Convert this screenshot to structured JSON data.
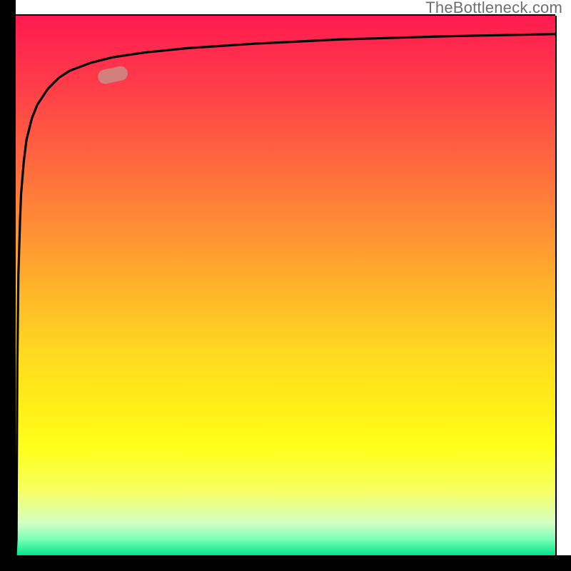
{
  "attribution": "TheBottleneck.com",
  "colors": {
    "axis": "#000000",
    "curve": "#000000",
    "marker_fill": "#ca8d87",
    "marker_opacity": 0.85,
    "gradient_stops": [
      {
        "offset": 0,
        "color": "#ff1a4f"
      },
      {
        "offset": 12,
        "color": "#ff3a4a"
      },
      {
        "offset": 25,
        "color": "#ff6140"
      },
      {
        "offset": 38,
        "color": "#ff8a36"
      },
      {
        "offset": 50,
        "color": "#ffb22a"
      },
      {
        "offset": 62,
        "color": "#ffd820"
      },
      {
        "offset": 72,
        "color": "#ffee18"
      },
      {
        "offset": 80,
        "color": "#ffff1a"
      },
      {
        "offset": 88,
        "color": "#f7ff60"
      },
      {
        "offset": 94,
        "color": "#d4ffc4"
      },
      {
        "offset": 97,
        "color": "#7bffb7"
      },
      {
        "offset": 100,
        "color": "#00e68a"
      }
    ]
  },
  "chart_data": {
    "type": "line",
    "title": "",
    "xlabel": "",
    "ylabel": "",
    "xlim": [
      0,
      100
    ],
    "ylim": [
      0,
      100
    ],
    "series": [
      {
        "name": "curve",
        "description": "Steep rise from origin approaching an upper asymptote near y≈97; visually a logarithmic/saturation-style curve.",
        "x": [
          0,
          0.15,
          0.2,
          0.3,
          0.5,
          0.8,
          1,
          1.5,
          2,
          3,
          4,
          6,
          8,
          10,
          14,
          18,
          24,
          32,
          44,
          60,
          80,
          100
        ],
        "y": [
          0,
          3,
          15,
          35,
          52,
          62,
          67,
          73,
          77,
          81,
          83.5,
          86.5,
          88.5,
          89.8,
          91.3,
          92.3,
          93.2,
          94.0,
          94.8,
          95.6,
          96.2,
          96.6
        ]
      }
    ],
    "marker": {
      "description": "Pill-shaped highlight on curve near the upper-left knee.",
      "x": 18,
      "y": 89,
      "shape": "rounded-rect",
      "approx_angle_deg": -12
    }
  }
}
